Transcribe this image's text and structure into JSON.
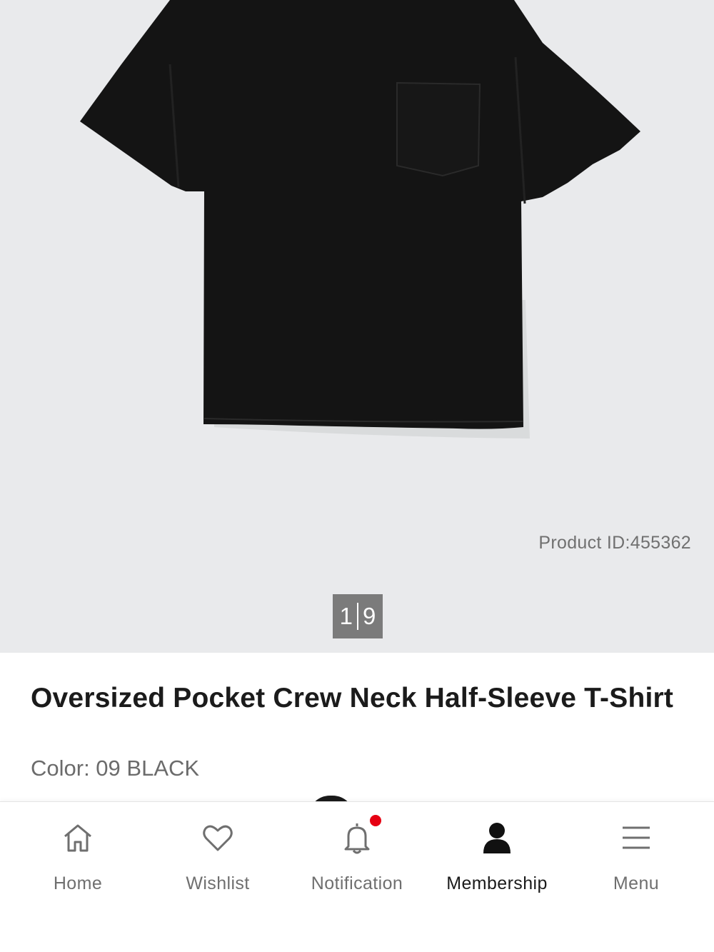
{
  "product": {
    "id_text": "Product ID:455362",
    "image_index": "1",
    "image_total": "9",
    "name": "Oversized Pocket Crew Neck Half-Sleeve T-Shirt",
    "color_text": "Color: 09 BLACK"
  },
  "bottom_nav": {
    "items": [
      {
        "label": "Home",
        "icon": "home-icon"
      },
      {
        "label": "Wishlist",
        "icon": "heart-icon"
      },
      {
        "label": "Notification",
        "icon": "bell-icon"
      },
      {
        "label": "Membership",
        "icon": "person-icon"
      },
      {
        "label": "Menu",
        "icon": "hamburger-icon"
      }
    ],
    "active": "Membership"
  },
  "colors": {
    "badge": "#e60012",
    "image_bg": "#e9eaec",
    "shirt": "#141414"
  }
}
